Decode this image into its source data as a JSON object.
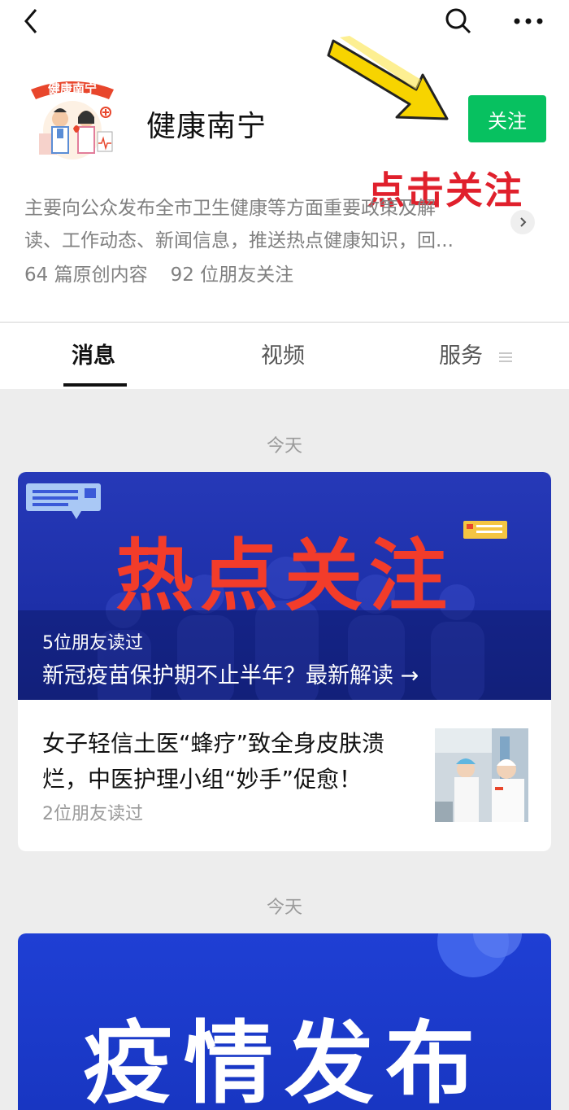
{
  "account": {
    "name": "健康南宁",
    "follow_label": "关注",
    "annotation": "点击关注",
    "description_line1": "主要向公众发布全市卫生健康等方面重要政策及解",
    "description_line2": "读、工作动态、新闻信息，推送热点健康知识，回...",
    "original_count": "64 篇原创内容",
    "friends_following": "92 位朋友关注"
  },
  "tabs": [
    {
      "label": "消息",
      "active": true
    },
    {
      "label": "视频",
      "active": false
    },
    {
      "label": "服务",
      "active": false
    }
  ],
  "feed": {
    "date_label_1": "今天",
    "date_label_2": "今天",
    "article1": {
      "banner_text": "热点关注",
      "friends_read": "5位朋友读过",
      "headline": "新冠疫苗保护期不止半年？最新解读 →"
    },
    "article2": {
      "title": "女子轻信土医“蜂疗”致全身皮肤溃烂，中医护理小组“妙手”促愈！",
      "friends_read": "2位朋友读过"
    },
    "article3": {
      "banner_text": "疫情发布"
    }
  },
  "colors": {
    "follow_green": "#07c160",
    "annotation_red": "#e0202c",
    "banner_blue": "#2639b8",
    "banner_title_red": "#f23c2a",
    "arrow_yellow": "#f7d400"
  },
  "icons": [
    "back-icon",
    "search-icon",
    "more-icon",
    "chevron-right-icon",
    "menu-icon",
    "arrow-annotation"
  ]
}
